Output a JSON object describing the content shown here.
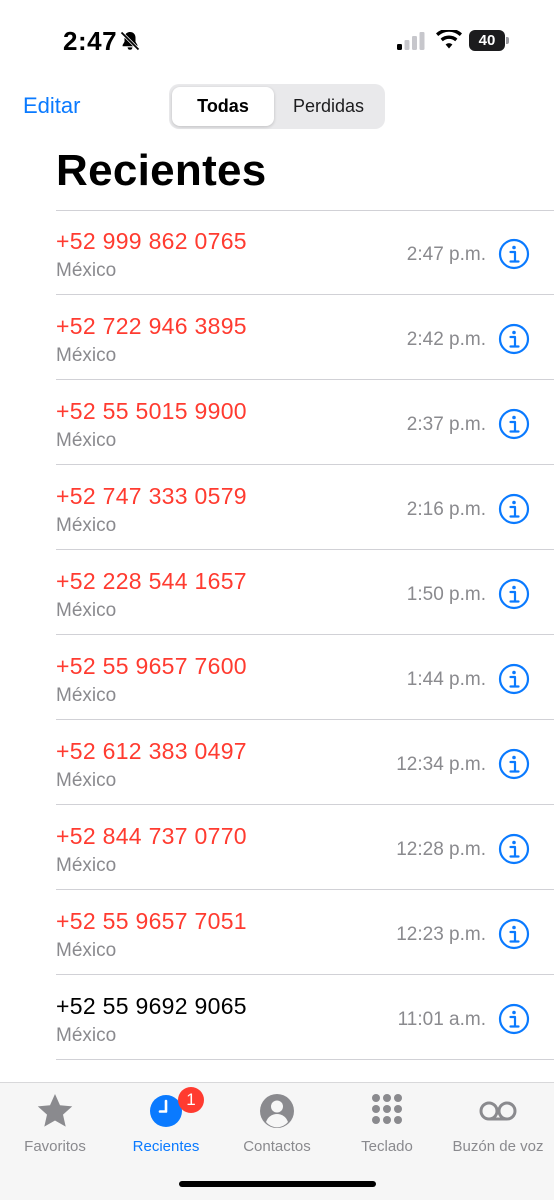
{
  "status_bar": {
    "time": "2:47",
    "battery": "40"
  },
  "nav": {
    "edit_label": "Editar",
    "segments": [
      "Todas",
      "Perdidas"
    ]
  },
  "title": "Recientes",
  "calls": [
    {
      "number": "+52 999 862 0765",
      "country": "México",
      "time": "2:47 p.m.",
      "missed": true
    },
    {
      "number": "+52 722 946 3895",
      "country": "México",
      "time": "2:42 p.m.",
      "missed": true
    },
    {
      "number": "+52 55 5015 9900",
      "country": "México",
      "time": "2:37 p.m.",
      "missed": true
    },
    {
      "number": "+52 747 333 0579",
      "country": "México",
      "time": "2:16 p.m.",
      "missed": true
    },
    {
      "number": "+52 228 544 1657",
      "country": "México",
      "time": "1:50 p.m.",
      "missed": true
    },
    {
      "number": "+52 55 9657 7600",
      "country": "México",
      "time": "1:44 p.m.",
      "missed": true
    },
    {
      "number": "+52 612 383 0497",
      "country": "México",
      "time": "12:34 p.m.",
      "missed": true
    },
    {
      "number": "+52 844 737 0770",
      "country": "México",
      "time": "12:28 p.m.",
      "missed": true
    },
    {
      "number": "+52 55 9657 7051",
      "country": "México",
      "time": "12:23 p.m.",
      "missed": true
    },
    {
      "number": "+52 55 9692 9065",
      "country": "México",
      "time": "11:01 a.m.",
      "missed": false
    }
  ],
  "tabs": [
    {
      "label": "Favoritos",
      "icon": "star-icon"
    },
    {
      "label": "Recientes",
      "icon": "clock-icon",
      "badge": "1",
      "active": true
    },
    {
      "label": "Contactos",
      "icon": "person-icon"
    },
    {
      "label": "Teclado",
      "icon": "keypad-icon"
    },
    {
      "label": "Buzón de voz",
      "icon": "voicemail-icon"
    }
  ],
  "colors": {
    "accent": "#0a7aff",
    "missed": "#ff3b30",
    "secondary": "#8a8a8e"
  }
}
